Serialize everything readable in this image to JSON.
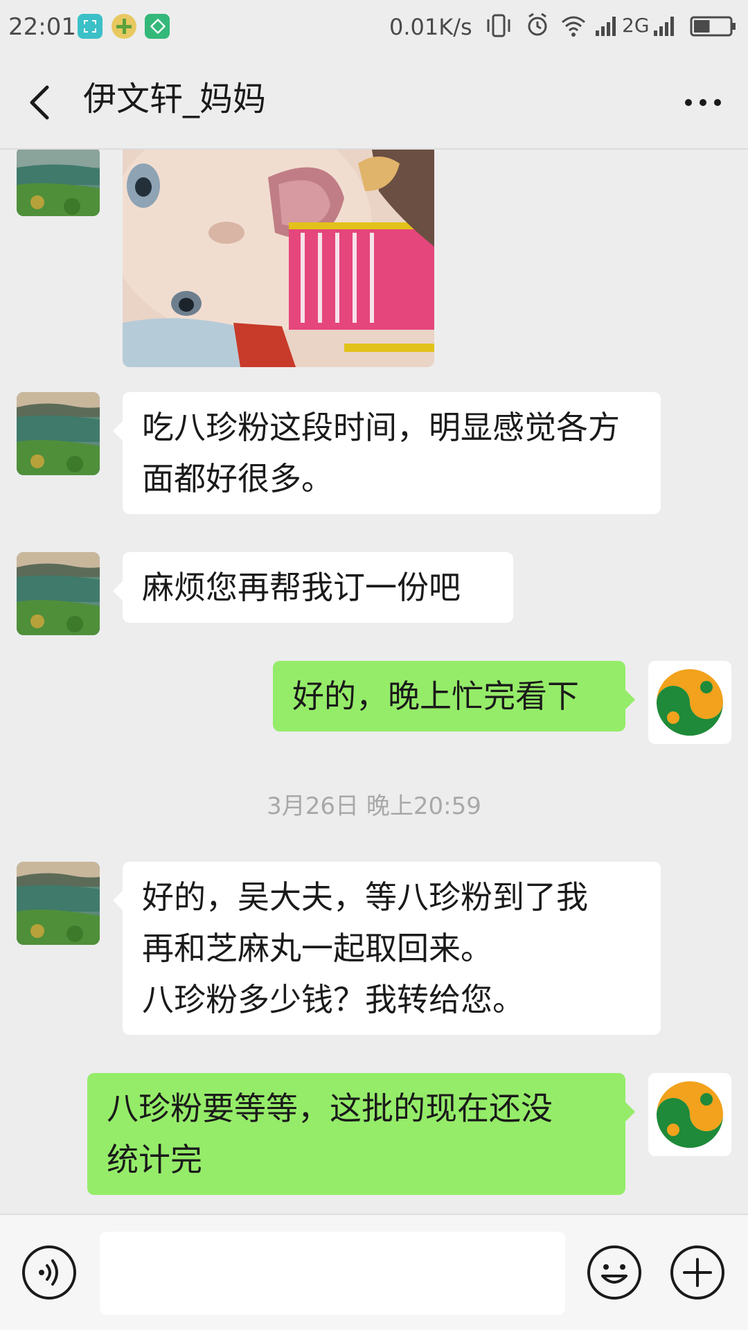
{
  "status_bar": {
    "time": "22:01",
    "net_speed": "0.01K/s",
    "network_type": "2G",
    "icons": [
      "screenshot-app-icon",
      "plus-app-icon",
      "diamond-app-icon",
      "vibrate-icon",
      "alarm-icon",
      "wifi-icon",
      "signal-icon",
      "signal-icon",
      "battery-icon"
    ],
    "battery_level": 0.45
  },
  "header": {
    "title": "伊文轩_妈妈",
    "back_icon": "chevron-left-icon",
    "more_icon": "more-dots-icon"
  },
  "messages": [
    {
      "sender": "contact",
      "type": "image",
      "content": "photo of baby"
    },
    {
      "sender": "contact",
      "type": "text",
      "text": "吃八珍粉这段时间，明显感觉各方面都好很多。"
    },
    {
      "sender": "contact",
      "type": "text",
      "text": "麻烦您再帮我订一份吧"
    },
    {
      "sender": "self",
      "type": "text",
      "text": "好的，晚上忙完看下"
    },
    {
      "type": "timestamp",
      "text": "3月26日 晚上20:59"
    },
    {
      "sender": "contact",
      "type": "text",
      "text": "好的，吴大夫，等八珍粉到了我\n再和芝麻丸一起取回来。\n八珍粉多少钱？我转给您。"
    },
    {
      "sender": "self",
      "type": "text",
      "text": "八珍粉要等等，这批的现在还没\n统计完"
    }
  ],
  "input_bar": {
    "text_value": "",
    "voice_icon": "voice-icon",
    "emoji_icon": "emoji-icon",
    "plus_icon": "plus-icon"
  },
  "colors": {
    "background": "#ededed",
    "incoming_bubble": "#ffffff",
    "outgoing_bubble": "#95ec69",
    "self_avatar_green": "#1f8a3a",
    "self_avatar_orange": "#f2a21c"
  }
}
